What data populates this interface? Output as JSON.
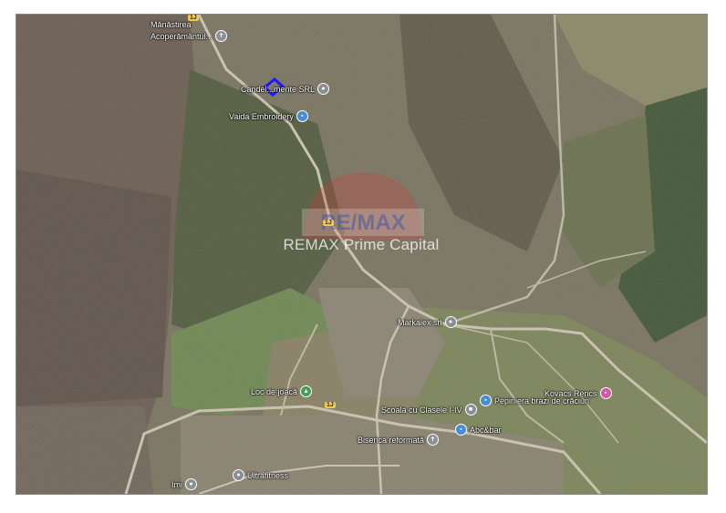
{
  "map": {
    "watermark": "REMAX Prime Capital",
    "logo_text": "RE/MAX",
    "parcel_color": "#1a1aff",
    "pois": [
      {
        "label": "Mănăstirea",
        "icon": "place-icon",
        "color": "grey"
      },
      {
        "label": "Acoperământul...",
        "icon": "church-icon",
        "color": "grey"
      },
      {
        "label": "Candel...mente SRL",
        "icon": "shop-icon",
        "color": "grey"
      },
      {
        "label": "Vaida Embroidery",
        "icon": "shop-icon",
        "color": "blue"
      },
      {
        "label": "Markalex srl",
        "icon": "shop-icon",
        "color": "grey"
      },
      {
        "label": "Loc de joacă",
        "icon": "playground-icon",
        "color": "green"
      },
      {
        "label": "Școala cu Clasele I-IV",
        "icon": "school-icon",
        "color": "grey"
      },
      {
        "label": "Pepiniera brazi de crăciun",
        "icon": "shop-icon",
        "color": "blue"
      },
      {
        "label": "Kovacs Rencs",
        "icon": "shop-icon",
        "color": "pink"
      },
      {
        "label": "Abc&bar",
        "icon": "shop-icon",
        "color": "blue"
      },
      {
        "label": "Biserica reformată",
        "icon": "church-icon",
        "color": "grey"
      },
      {
        "label": "Ultrafitness",
        "icon": "gym-icon",
        "color": "grey"
      },
      {
        "label": "Imi",
        "icon": "place-icon",
        "color": "grey"
      }
    ],
    "road_badges": [
      "1J",
      "1J",
      "1J"
    ]
  }
}
